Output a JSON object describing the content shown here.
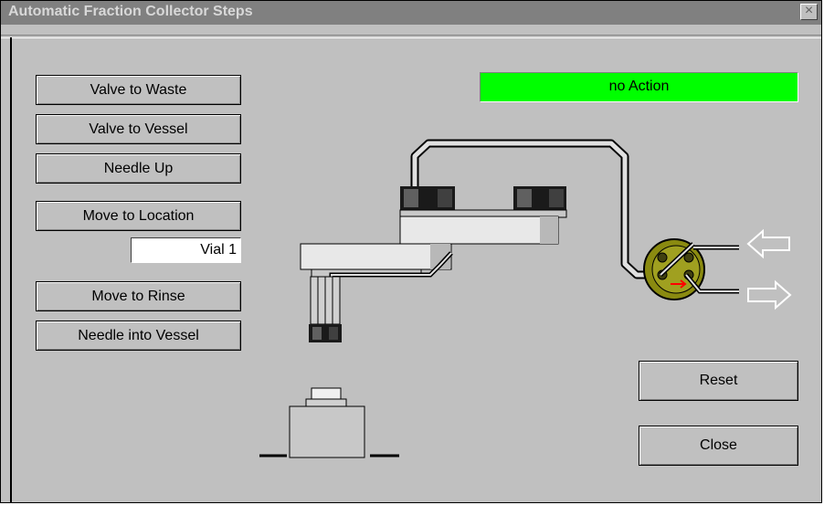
{
  "window": {
    "title": "Automatic Fraction Collector Steps",
    "close_glyph": "×"
  },
  "status": {
    "text": "no Action",
    "color": "#00ff00"
  },
  "buttons": {
    "valve_to_waste": "Valve to Waste",
    "valve_to_vessel": "Valve to Vessel",
    "needle_up": "Needle Up",
    "move_to_location": "Move to Location",
    "move_to_rinse": "Move to Rinse",
    "needle_into_vessel": "Needle into Vessel",
    "reset": "Reset",
    "close": "Close"
  },
  "location_field": {
    "value": "Vial 1"
  },
  "colors": {
    "background": "#c0c0c0",
    "titlebar": "#808080",
    "valve": "#8a8a10",
    "status_green": "#00ff00"
  },
  "diagram": {
    "components": [
      "robot-arm",
      "needle-assembly",
      "vial",
      "selector-valve",
      "inlet-arrow-icon",
      "outlet-arrow-icon"
    ]
  }
}
